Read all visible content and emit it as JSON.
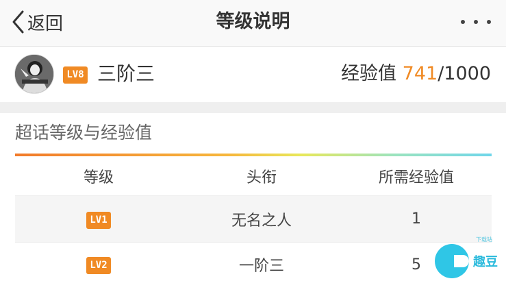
{
  "navbar": {
    "back_label": "返回",
    "title": "等级说明",
    "more_icon": "more-horizontal-icon"
  },
  "profile": {
    "avatar_icon": "user-avatar",
    "level_badge": "LV8",
    "rank_name": "三阶三",
    "exp_label": "经验值",
    "exp_current": "741",
    "exp_total": "/1000"
  },
  "section": {
    "title": "超话等级与经验值"
  },
  "table": {
    "headers": [
      "等级",
      "头衔",
      "所需经验值"
    ],
    "rows": [
      {
        "level": "LV1",
        "title": "无名之人",
        "exp": "1"
      },
      {
        "level": "LV2",
        "title": "一阶三",
        "exp": "5"
      }
    ]
  },
  "watermark": {
    "text": "趣豆",
    "small": "下载站"
  },
  "colors": {
    "accent": "#f08a24",
    "gradient_start": "#f27a2a",
    "gradient_end": "#6fd6ea"
  }
}
